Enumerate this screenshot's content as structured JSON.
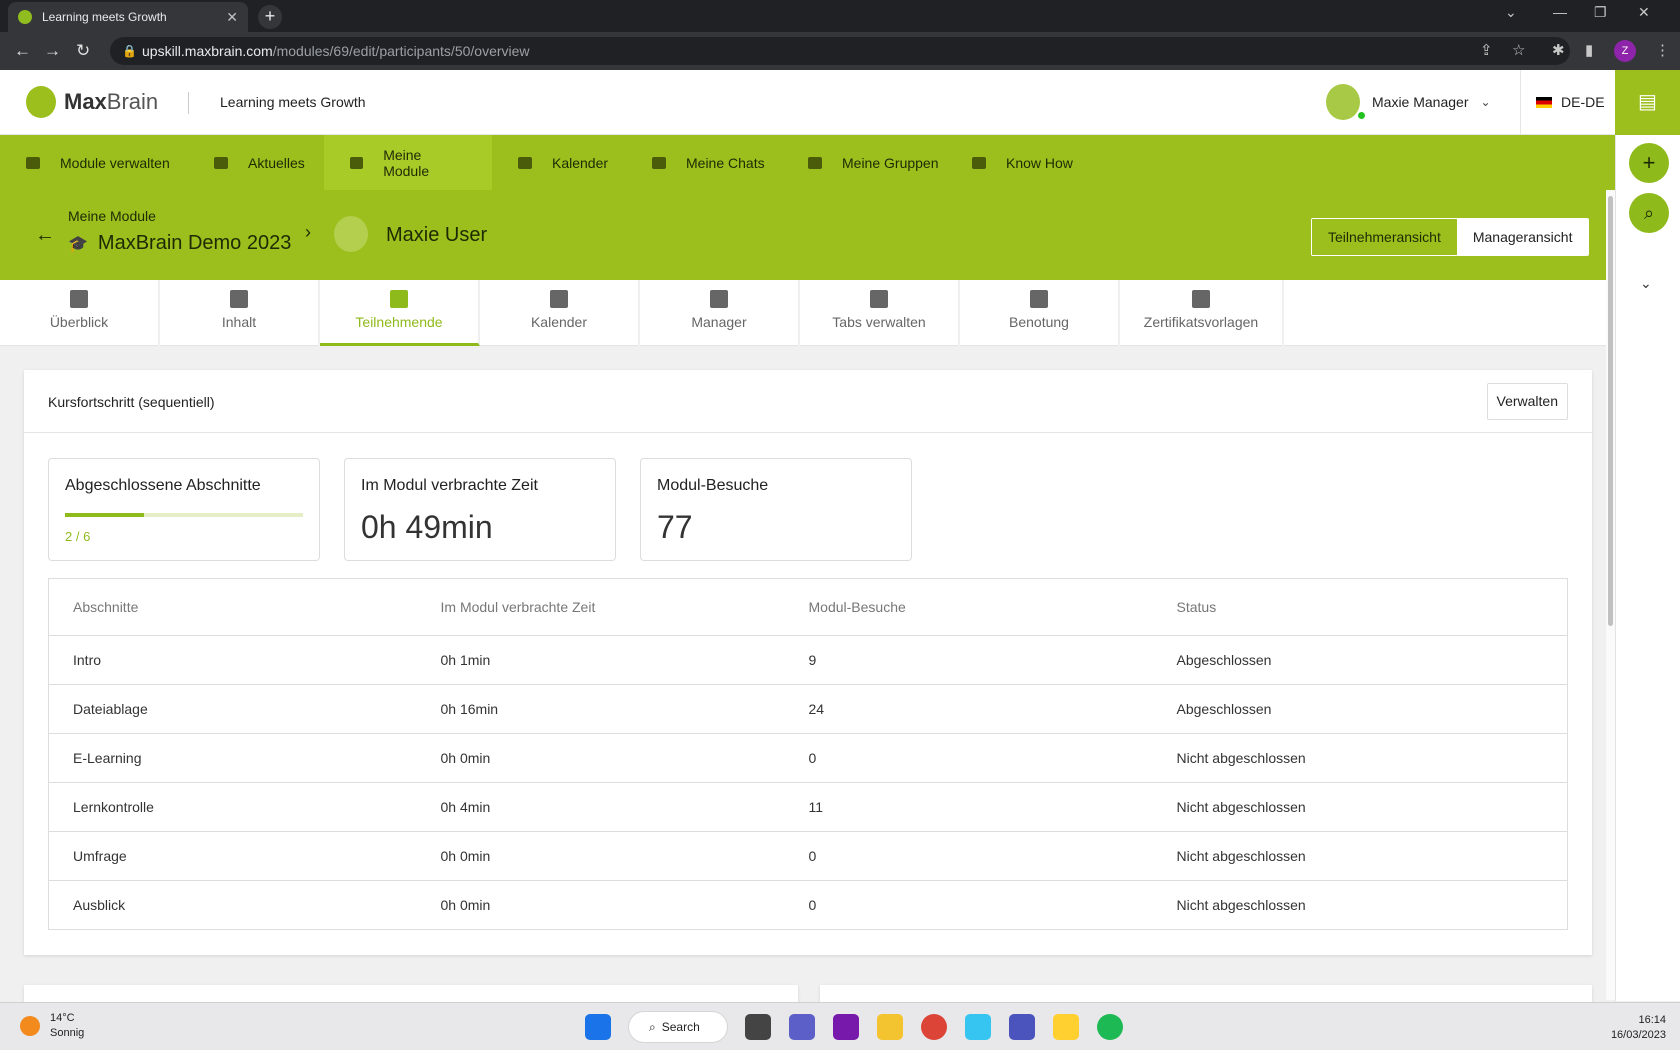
{
  "browser": {
    "tab_title": "Learning meets Growth",
    "url_host": "upskill.maxbrain.com",
    "url_path": "/modules/69/edit/participants/50/overview",
    "profile_initial": "Z"
  },
  "header": {
    "logo_max": "Max",
    "logo_brain": "Brain",
    "tagline": "Learning meets Growth",
    "user_name": "Maxie Manager",
    "language": "DE-DE"
  },
  "nav": {
    "items": [
      {
        "label": "Module verwalten"
      },
      {
        "label": "Aktuelles"
      },
      {
        "label": "Meine Module"
      },
      {
        "label": "Kalender"
      },
      {
        "label": "Meine Chats"
      },
      {
        "label": "Meine Gruppen"
      },
      {
        "label": "Know How"
      }
    ]
  },
  "breadcrumb": {
    "parent": "Meine Module",
    "module": "MaxBrain Demo 2023",
    "participant": "Maxie User"
  },
  "view_toggle": {
    "participant_view": "Teilnehmeransicht",
    "manager_view": "Manageransicht"
  },
  "tabs": [
    {
      "label": "Überblick"
    },
    {
      "label": "Inhalt"
    },
    {
      "label": "Teilnehmende"
    },
    {
      "label": "Kalender"
    },
    {
      "label": "Manager"
    },
    {
      "label": "Tabs verwalten"
    },
    {
      "label": "Benotung"
    },
    {
      "label": "Zertifikatsvorlagen"
    }
  ],
  "card": {
    "title": "Kursfortschritt (sequentiell)",
    "manage_label": "Verwalten",
    "stats": {
      "sections_label": "Abgeschlossene Abschnitte",
      "sections_value": "2 / 6",
      "sections_progress": 0.333,
      "time_label": "Im Modul verbrachte Zeit",
      "time_value": "0h 49min",
      "visits_label": "Modul-Besuche",
      "visits_value": "77"
    },
    "table": {
      "headers": [
        "Abschnitte",
        "Im Modul verbrachte Zeit",
        "Modul-Besuche",
        "Status"
      ],
      "rows": [
        [
          "Intro",
          "0h 1min",
          "9",
          "Abgeschlossen"
        ],
        [
          "Dateiablage",
          "0h 16min",
          "24",
          "Abgeschlossen"
        ],
        [
          "E-Learning",
          "0h 0min",
          "0",
          "Nicht abgeschlossen"
        ],
        [
          "Lernkontrolle",
          "0h 4min",
          "11",
          "Nicht abgeschlossen"
        ],
        [
          "Umfrage",
          "0h 0min",
          "0",
          "Nicht abgeschlossen"
        ],
        [
          "Ausblick",
          "0h 0min",
          "0",
          "Nicht abgeschlossen"
        ]
      ]
    }
  },
  "taskbar": {
    "temp": "14°C",
    "weather": "Sonnig",
    "search": "Search",
    "time": "16:14",
    "date": "16/03/2023"
  },
  "colors": {
    "accent": "#9cbf1d",
    "accent_dark": "#8fba1c"
  }
}
